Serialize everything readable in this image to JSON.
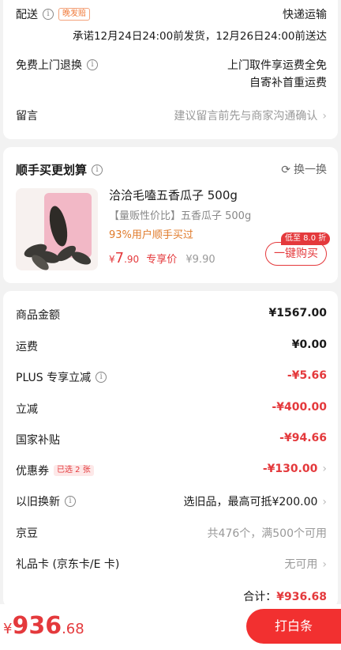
{
  "delivery": {
    "label": "配送",
    "badge": "晚发赔",
    "method": "快递运输",
    "promise": "承诺12月24日24:00前发货，12月26日24:00前送达"
  },
  "returns": {
    "label": "免费上门退换",
    "line1": "上门取件享运费全免",
    "line2": "自寄补首重运费"
  },
  "message": {
    "label": "留言",
    "placeholder": "建议留言前先与商家沟通确认"
  },
  "addon": {
    "title": "顺手买更划算",
    "refresh_label": "换一换",
    "product_name": "洽洽毛嗑五香瓜子 500g",
    "product_sub": "【量贩性价比】五香瓜子 500g",
    "social_proof": "93%用户顺手买过",
    "price_symbol": "¥",
    "price_int": "7",
    "price_dec": ".90",
    "price_tag": "专享价",
    "original_price": "¥9.90",
    "buy_label": "一键购买",
    "buy_tag": "低至 8.0 折"
  },
  "summary": {
    "rows": [
      {
        "label": "商品金额",
        "value": "¥1567.00"
      },
      {
        "label": "运费",
        "value": "¥0.00"
      },
      {
        "label": "PLUS 专享立减",
        "value": "-¥5.66"
      },
      {
        "label": "立减",
        "value": "-¥400.00"
      },
      {
        "label": "国家补贴",
        "value": "-¥94.66"
      },
      {
        "label": "优惠券",
        "badge": "已选 2 张",
        "value": "-¥130.00"
      },
      {
        "label": "以旧换新",
        "value": "选旧品，最高可抵¥200.00"
      },
      {
        "label": "京豆",
        "value": "共476个，满500个可用"
      },
      {
        "label": "礼品卡 (京东卡/E 卡)",
        "value": "无可用"
      }
    ],
    "total_label": "合计：",
    "total_value": "¥936.68"
  },
  "bottom": {
    "symbol": "¥",
    "amount_int": "936",
    "amount_dec": ".68",
    "pay_label": "打白条"
  },
  "colors": {
    "accent": "#e4393c",
    "price_red": "#e4393c",
    "social_orange": "#e07b2b"
  }
}
